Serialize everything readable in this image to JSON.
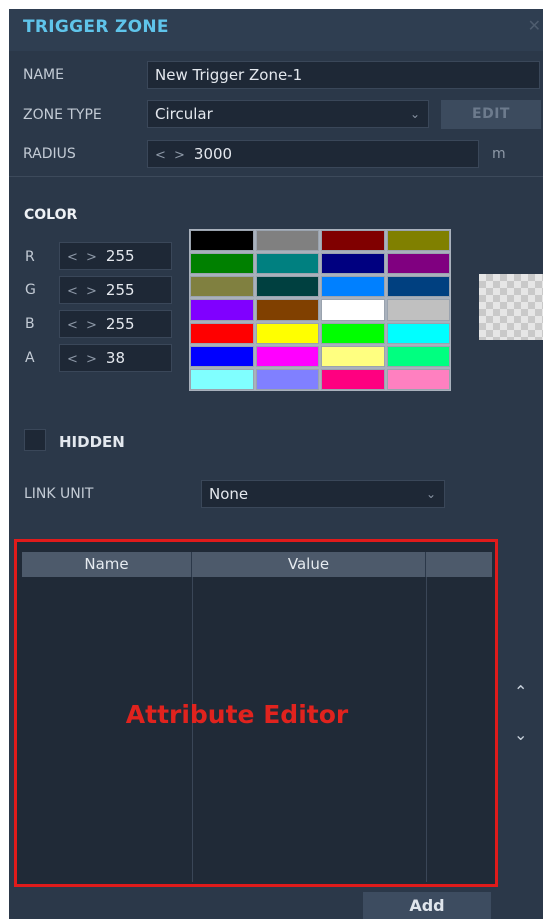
{
  "window": {
    "title": "TRIGGER ZONE",
    "close_glyph": "✕"
  },
  "name": {
    "label": "NAME",
    "value": "New Trigger Zone-1"
  },
  "zone_type": {
    "label": "ZONE TYPE",
    "value": "Circular",
    "edit_label": "EDIT"
  },
  "radius": {
    "label": "RADIUS",
    "value": "3000",
    "unit": "m"
  },
  "color": {
    "heading": "COLOR",
    "channels": [
      {
        "label": "R",
        "value": "255"
      },
      {
        "label": "G",
        "value": "255"
      },
      {
        "label": "B",
        "value": "255"
      },
      {
        "label": "A",
        "value": "38"
      }
    ],
    "palette": [
      "#000000",
      "#808080",
      "#800000",
      "#808000",
      "#008000",
      "#008080",
      "#000080",
      "#800080",
      "#808040",
      "#004040",
      "#0080ff",
      "#004080",
      "#8000ff",
      "#804000",
      "#ffffff",
      "#c0c0c0",
      "#ff0000",
      "#ffff00",
      "#00ff00",
      "#00ffff",
      "#0000ff",
      "#ff00ff",
      "#ffff80",
      "#00ff80",
      "#80ffff",
      "#8080ff",
      "#ff0080",
      "#ff80c0"
    ]
  },
  "hidden": {
    "label": "HIDDEN",
    "checked": false
  },
  "link_unit": {
    "label": "LINK UNIT",
    "value": "None"
  },
  "attribute_table": {
    "columns": [
      "Name",
      "Value",
      ""
    ],
    "overlay_label": "Attribute Editor"
  },
  "icons": {
    "spinner": "< >",
    "dropdown": "⌄",
    "scroll_up": "⌃",
    "scroll_down": "⌄"
  },
  "add_label": "Add"
}
